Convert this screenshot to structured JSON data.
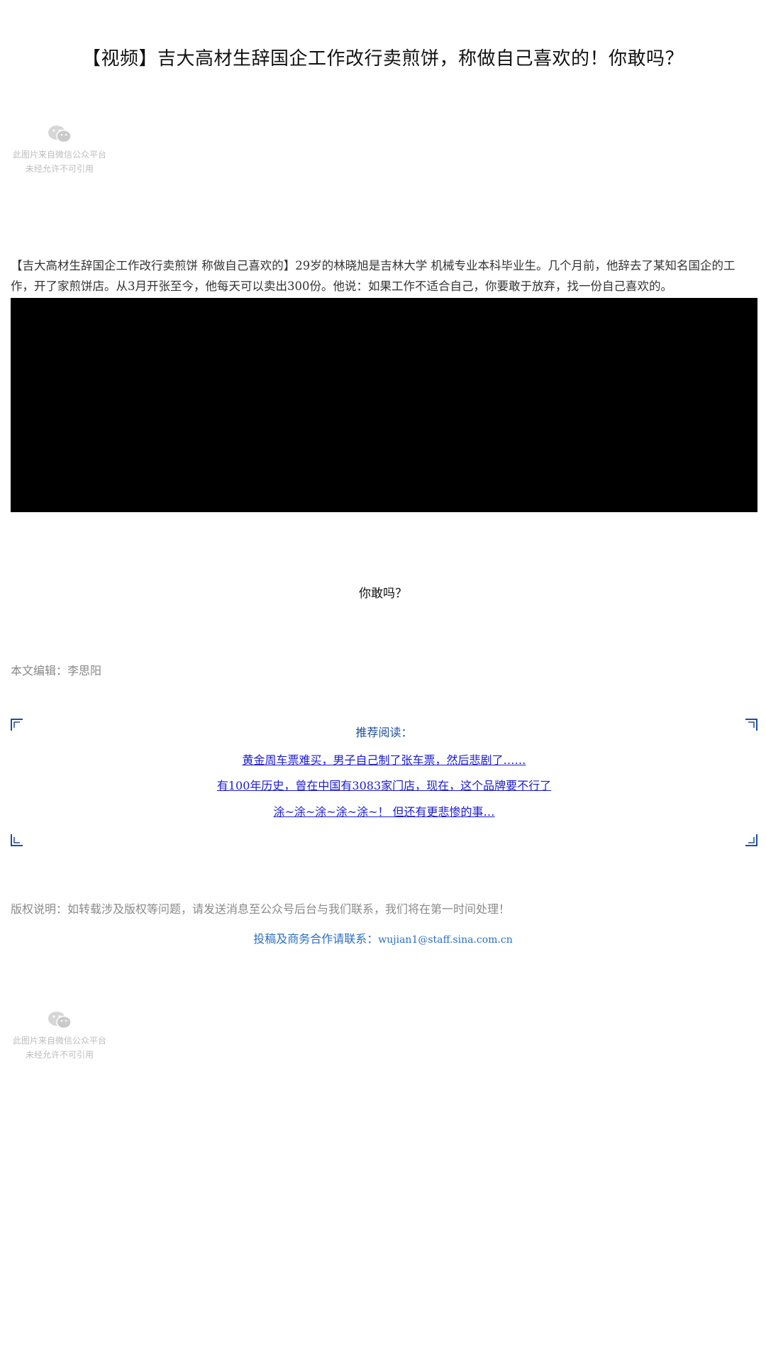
{
  "article": {
    "title": "【视频】吉大高材生辞国企工作改行卖煎饼，称做自己喜欢的！你敢吗？",
    "intro": "【吉大高材生辞国企工作改行卖煎饼  称做自己喜欢的】29岁的林晓旭是吉林大学  机械专业本科毕业生。几个月前，他辞去了某知名国企的工作，开了家煎饼店。从3月开张至今，他每天可以卖出300份。他说：如果工作不适合自己，你要敢于放弃，找一份自己喜欢的。",
    "question": "你敢吗？",
    "editor": "本文编辑：李思阳"
  },
  "placeholder_image": {
    "line1": "此图片来自微信公众平台",
    "line2": "未经允许不可引用",
    "icon": "wechat-icon"
  },
  "recommend": {
    "title": "推荐阅读：",
    "links": [
      "黄金周车票难买，男子自己制了张车票，然后悲剧了……",
      "有100年历史，曾在中国有3083家门店，现在，这个品牌要不行了",
      "涂~涂~涂~涂~涂~！ 但还有更悲惨的事…"
    ]
  },
  "footer": {
    "copyright": "版权说明：如转载涉及版权等问题，请发送消息至公众号后台与我们联系，我们将在第一时间处理！",
    "contact_label": "投稿及商务合作请联系：",
    "contact_email": "wujian1@staff.sina.com.cn"
  },
  "colors": {
    "link": "#1a1ad6",
    "accent": "#1e4f9c",
    "contact": "#2a6fc4",
    "muted": "#8a8a8a",
    "video_bg": "#000000"
  }
}
